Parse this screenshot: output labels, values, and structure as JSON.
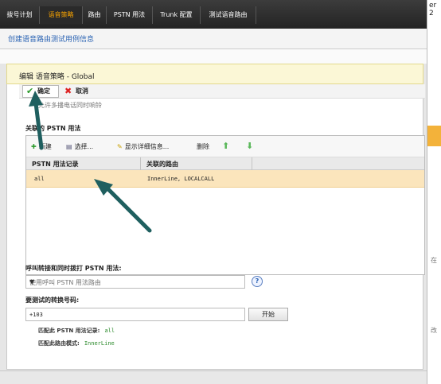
{
  "nav": {
    "tabs": [
      {
        "label": "拨号计划"
      },
      {
        "label": "语音策略"
      },
      {
        "label": "路由"
      },
      {
        "label": "PSTN 用法"
      },
      {
        "label": "Trunk 配置"
      },
      {
        "label": "测试语音路由"
      }
    ],
    "active_index": 1
  },
  "right_strip": {
    "top_text": "er 2",
    "mid_text": "在",
    "low_text": "改"
  },
  "subtitle": "创建语音路由测试用例信息",
  "dialog": {
    "title": "编辑 语音策略 - Global",
    "ok_label": "确定",
    "cancel_label": "取消",
    "hidden_option": "允许多播电话同时响铃",
    "pstn_section_label": "关联的 PSTN 用法",
    "grid_toolbar": {
      "new": "新建",
      "select": "选择...",
      "details": "显示详细信息...",
      "delete": "删除"
    },
    "grid": {
      "columns": [
        "PSTN 用法记录",
        "关联的路由"
      ],
      "rows": [
        {
          "usage": "all",
          "routes": "InnerLine, LOCALCALL"
        }
      ]
    },
    "simul_ring_label": "呼叫转接和同时拨打 PSTN 用法:",
    "simul_ring_value": "使用呼叫 PSTN 用法路由",
    "test_number_label": "要测试的转换号码:",
    "test_number_value": "+103",
    "start_button": "开始",
    "result_usage_label": "匹配此 PSTN 用法记录:",
    "result_usage_value": "all",
    "result_route_label": "匹配此路由模式:",
    "result_route_value": "InnerLine"
  },
  "colors": {
    "accent": "#f7a300",
    "arrow": "#1f5f5f",
    "row_highlight": "#fbe5bc",
    "link": "#2a63b3"
  }
}
